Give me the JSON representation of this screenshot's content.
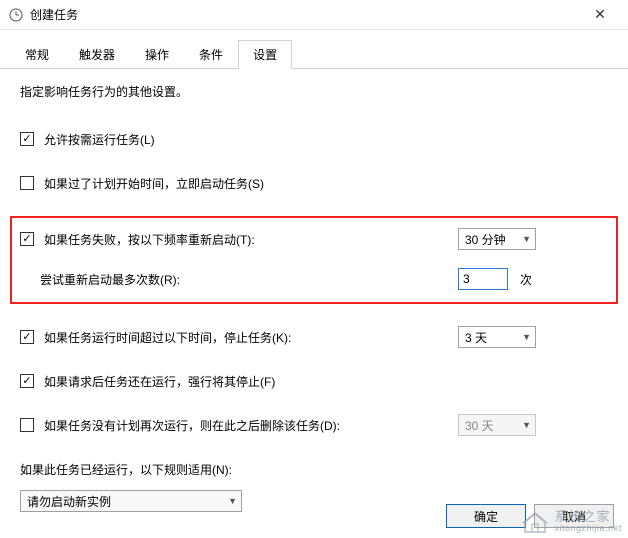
{
  "window": {
    "title": "创建任务"
  },
  "tabs": [
    {
      "label": "常规"
    },
    {
      "label": "触发器"
    },
    {
      "label": "操作"
    },
    {
      "label": "条件"
    },
    {
      "label": "设置"
    }
  ],
  "active_tab_index": 4,
  "description": "指定影响任务行为的其他设置。",
  "settings": {
    "allow_on_demand": {
      "checked": true,
      "label": "允许按需运行任务(L)"
    },
    "start_if_missed": {
      "checked": false,
      "label": "如果过了计划开始时间，立即启动任务(S)"
    },
    "restart_on_fail": {
      "checked": true,
      "label": "如果任务失败，按以下频率重新启动(T):",
      "interval": "30 分钟",
      "retry_label": "尝试重新启动最多次数(R):",
      "retry_value": "3",
      "retry_suffix": "次"
    },
    "stop_if_longer": {
      "checked": true,
      "label": "如果任务运行时间超过以下时间，停止任务(K):",
      "value": "3 天"
    },
    "force_stop": {
      "checked": true,
      "label": "如果请求后任务还在运行，强行将其停止(F)"
    },
    "delete_if_not_scheduled": {
      "checked": false,
      "label": "如果任务没有计划再次运行，则在此之后删除该任务(D):",
      "value": "30 天"
    },
    "if_already_running_label": "如果此任务已经运行，以下规则适用(N):",
    "if_already_running_value": "请勿启动新实例"
  },
  "buttons": {
    "ok": "确定",
    "cancel": "取消"
  },
  "watermark": {
    "main": "系统之家",
    "sub": "xitongzhijia.net"
  }
}
